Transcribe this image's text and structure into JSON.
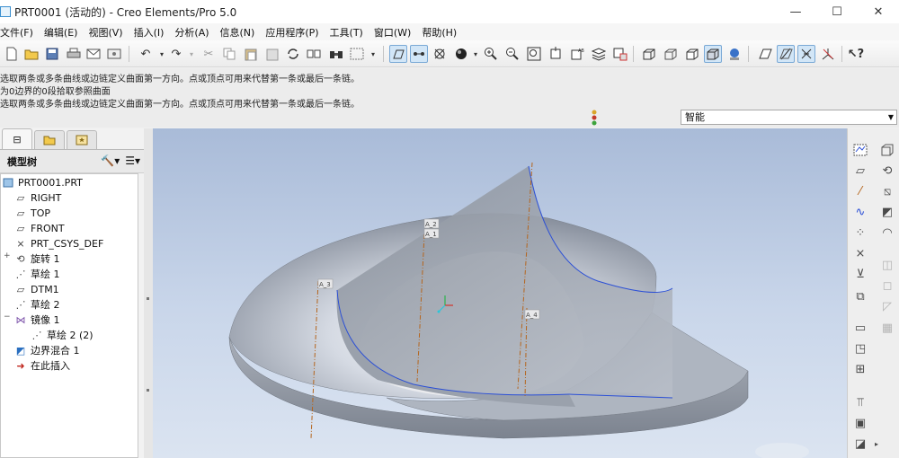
{
  "window": {
    "title": "PRT0001 (活动的) - Creo Elements/Pro 5.0",
    "buttons": [
      "—",
      "☐",
      "✕"
    ]
  },
  "menu": [
    "文件(F)",
    "编辑(E)",
    "视图(V)",
    "插入(I)",
    "分析(A)",
    "信息(N)",
    "应用程序(P)",
    "工具(T)",
    "窗口(W)",
    "帮助(H)"
  ],
  "messages": [
    "选取两条或多条曲线或边链定义曲面第一方向。点或顶点可用来代替第一条或最后一条链。",
    "为0边界的0段拾取参照曲面",
    "选取两条或多条曲线或边链定义曲面第一方向。点或顶点可用来代替第一条或最后一条链。"
  ],
  "filter": {
    "value": "智能"
  },
  "panel": {
    "tabs": [
      "tree-tab",
      "folder-tab",
      "favorites-tab"
    ],
    "tree_title": "模型树",
    "items": [
      {
        "label": "PRT0001.PRT",
        "icon": "part-icon"
      },
      {
        "label": "RIGHT",
        "icon": "datum-plane-icon"
      },
      {
        "label": "TOP",
        "icon": "datum-plane-icon"
      },
      {
        "label": "FRONT",
        "icon": "datum-plane-icon"
      },
      {
        "label": "PRT_CSYS_DEF",
        "icon": "csys-icon"
      },
      {
        "label": "旋转 1",
        "icon": "revolve-icon"
      },
      {
        "label": "草绘 1",
        "icon": "sketch-icon"
      },
      {
        "label": "DTM1",
        "icon": "datum-plane-icon"
      },
      {
        "label": "草绘 2",
        "icon": "sketch-icon"
      },
      {
        "label": "镜像 1",
        "icon": "mirror-icon"
      },
      {
        "label": "草绘 2 (2)",
        "icon": "sketch-icon"
      },
      {
        "label": "边界混合 1",
        "icon": "boundary-blend-icon"
      },
      {
        "label": "在此插入",
        "icon": "insert-here-arrow-icon"
      }
    ]
  },
  "viewport": {
    "datum_labels": [
      "A_2",
      "A_1",
      "A_3",
      "A_4"
    ],
    "colors": {
      "background_top": "#a9bbd8",
      "background_bottom": "#dbe4f1",
      "surface_edge": "#2b4fd6",
      "axis": "#b5651d"
    }
  }
}
